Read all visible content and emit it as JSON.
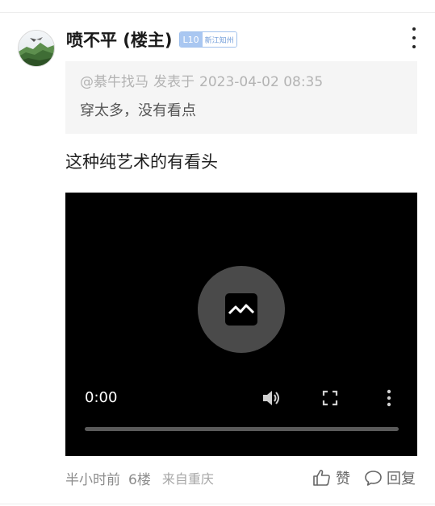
{
  "post": {
    "username": "喷不平 (楼主)",
    "level": "L10",
    "region_badge": "新江知州",
    "quote": {
      "author": "@綦牛找马",
      "published_label": "发表于",
      "datetime": "2023-04-02 08:35",
      "text": "穿太多，没有看点"
    },
    "body": "这种纯艺术的有看头",
    "video": {
      "current_time": "0:00",
      "progress": 0
    },
    "footer": {
      "time_ago": "半小时前",
      "floor": "6楼",
      "source": "来自重庆",
      "like_label": "赞",
      "reply_label": "回复"
    }
  },
  "colors": {
    "badge_blue": "#a9c7f1",
    "quote_bg": "#f5f5f5",
    "video_bg": "#000000"
  },
  "icons": {
    "more": "more-vertical-icon",
    "broken_image": "broken-image-icon",
    "volume": "volume-icon",
    "fullscreen": "fullscreen-icon",
    "like": "thumbs-up-icon",
    "reply": "comment-icon"
  }
}
